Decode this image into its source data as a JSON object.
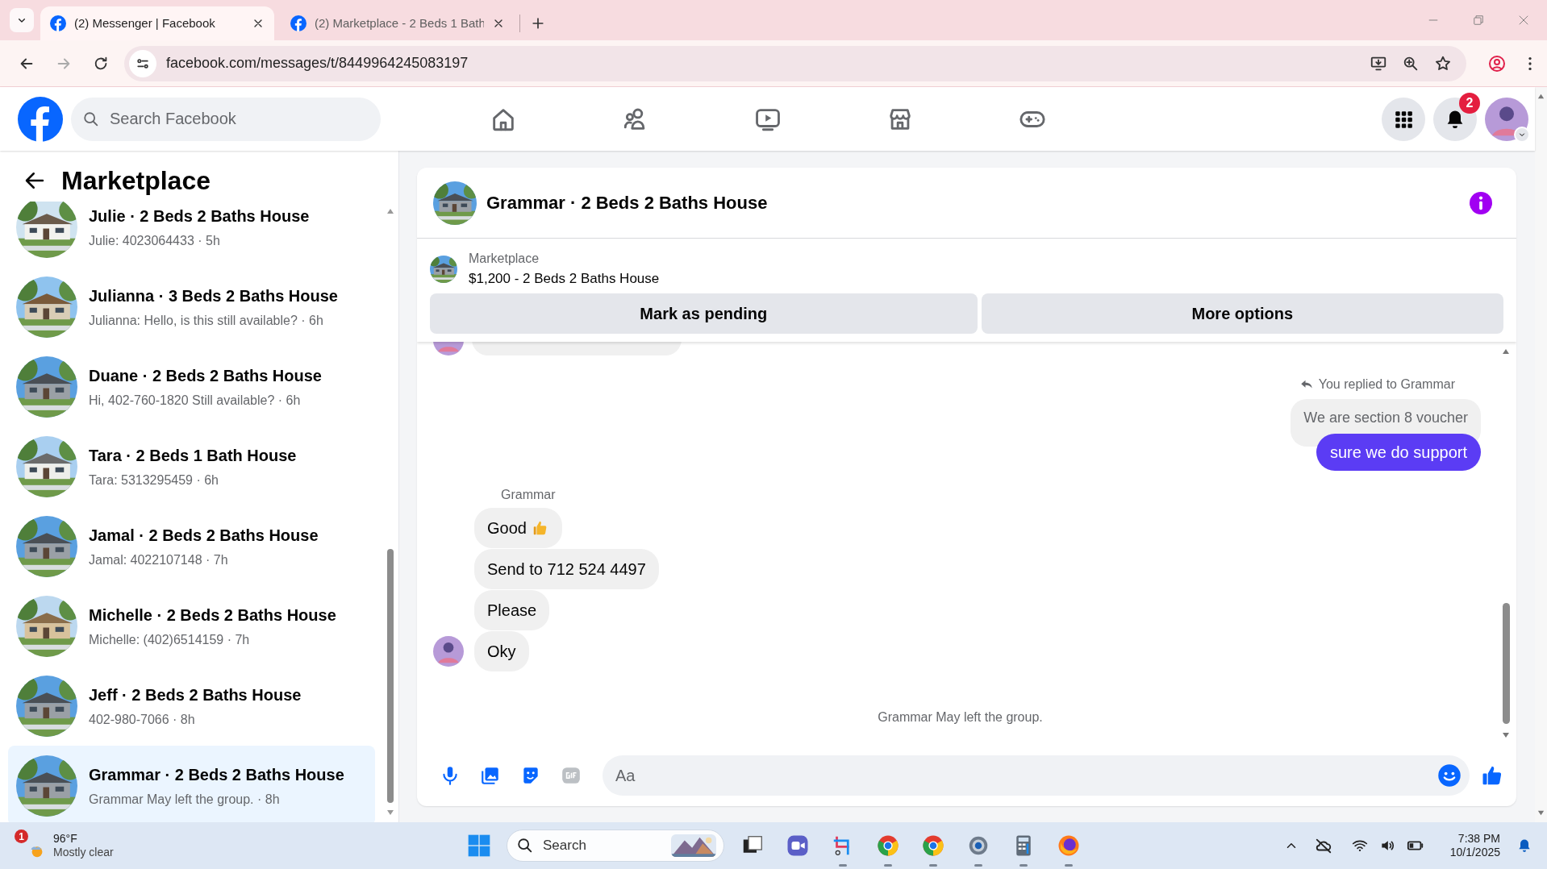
{
  "browser": {
    "tabs": [
      {
        "title": "(2) Messenger | Facebook",
        "selected": true
      },
      {
        "title": "(2) Marketplace - 2 Beds 1 Bath",
        "selected": false
      }
    ],
    "url": "facebook.com/messages/t/8449964245083197"
  },
  "header": {
    "search_placeholder": "Search Facebook",
    "nav": [
      {
        "kind": "home"
      },
      {
        "kind": "friends"
      },
      {
        "kind": "video"
      },
      {
        "kind": "marketplace"
      },
      {
        "kind": "gaming"
      }
    ],
    "notification_count": "2"
  },
  "sidebar": {
    "title": "Marketplace",
    "conversations": [
      {
        "title": "Julie · 2 Beds 2 Baths House",
        "preview": "Julie: 4023064433 · 5h",
        "selected": false
      },
      {
        "title": "Julianna · 3 Beds 2 Baths House",
        "preview": "Julianna: Hello, is this still available? · 6h",
        "selected": false
      },
      {
        "title": "Duane · 2 Beds 2 Baths House",
        "preview": "Hi, 402-760-1820 Still available? · 6h",
        "selected": false
      },
      {
        "title": "Tara · 2 Beds 1 Bath House",
        "preview": "Tara: 5313295459 · 6h",
        "selected": false
      },
      {
        "title": "Jamal · 2 Beds 2 Baths House",
        "preview": "Jamal: 4022107148 · 7h",
        "selected": false
      },
      {
        "title": "Michelle · 2 Beds 2 Baths House",
        "preview": "Michelle: (402)6514159 · 7h",
        "selected": false
      },
      {
        "title": "Jeff · 2 Beds 2 Baths House",
        "preview": "402-980-7066 · 8h",
        "selected": false
      },
      {
        "title": "Grammar · 2 Beds 2 Baths House",
        "preview": "Grammar May left the group. · 8h",
        "selected": true
      }
    ]
  },
  "chat": {
    "title": "Grammar · 2 Beds 2 Baths House",
    "listing": {
      "label": "Marketplace",
      "item": "$1,200 - 2 Beds 2 Baths House"
    },
    "actions": [
      "Mark as pending",
      "More options"
    ],
    "messages": [
      {
        "kind": "hidden",
        "avatar": true
      },
      {
        "kind": "reply_note",
        "text": "You replied to Grammar"
      },
      {
        "kind": "quoted",
        "text": "We are section 8 voucher"
      },
      {
        "kind": "outgoing",
        "text": "sure we do support"
      },
      {
        "kind": "sender",
        "text": "Grammar"
      },
      {
        "kind": "incoming",
        "text": "Good",
        "emoji": true,
        "avatar": false
      },
      {
        "kind": "incoming",
        "text": "Send to 712 524 4497",
        "emoji": false,
        "avatar": false
      },
      {
        "kind": "incoming",
        "text": "Please",
        "emoji": false,
        "avatar": false
      },
      {
        "kind": "incoming",
        "text": "Oky",
        "emoji": false,
        "avatar": true
      },
      {
        "kind": "system",
        "text": "Grammar May left the group."
      }
    ],
    "composer": {
      "placeholder": "Aa"
    }
  },
  "taskbar": {
    "weather": {
      "badge": "1",
      "temperature": "96°F",
      "condition": "Mostly clear"
    },
    "search_placeholder": "Search",
    "apps": [
      {
        "kind": "taskview",
        "running": false
      },
      {
        "kind": "meet",
        "running": false
      },
      {
        "kind": "snip",
        "running": true
      },
      {
        "kind": "chrome",
        "running": true
      },
      {
        "kind": "chrome",
        "running": true
      },
      {
        "kind": "settings",
        "running": true
      },
      {
        "kind": "calculator",
        "running": true
      },
      {
        "kind": "firefox",
        "running": true
      }
    ],
    "time": "7:38 PM",
    "date": "10/1/2025"
  }
}
